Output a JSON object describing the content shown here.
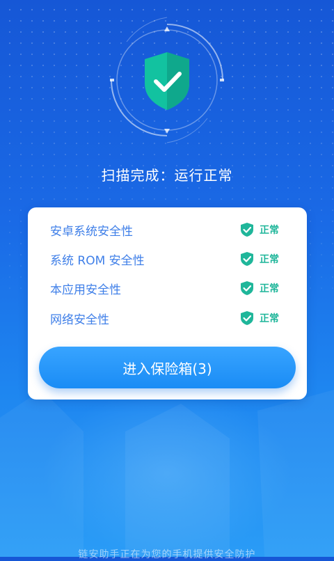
{
  "header": {
    "status_text": "扫描完成：运行正常"
  },
  "checks": [
    {
      "label": "安卓系统安全性",
      "status": "正常",
      "icon": "shield-check-icon"
    },
    {
      "label": "系统 ROM 安全性",
      "status": "正常",
      "icon": "shield-check-icon"
    },
    {
      "label": "本应用安全性",
      "status": "正常",
      "icon": "shield-check-icon"
    },
    {
      "label": "网络安全性",
      "status": "正常",
      "icon": "shield-check-icon"
    }
  ],
  "vault_button": {
    "label": "进入保险箱(3)"
  },
  "footer": {
    "text": "链安助手正在为您的手机提供安全防护"
  },
  "colors": {
    "background_top": "#1657d6",
    "background_bottom": "#2a9cf6",
    "shield_green": "#1fb69a",
    "label_blue": "#3f7fe8",
    "button_blue": "#1a8cf5"
  }
}
